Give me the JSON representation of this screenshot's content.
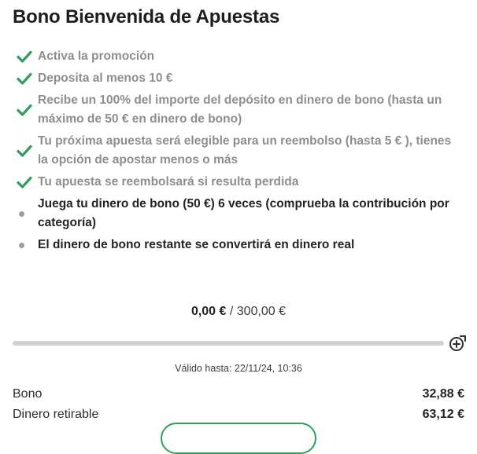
{
  "title": "Bono Bienvenida de Apuestas",
  "steps": [
    {
      "text": "Activa la promoción",
      "status": "done"
    },
    {
      "text": "Deposita al menos 10 €",
      "status": "done"
    },
    {
      "text": "Recibe un 100% del importe del depósito en dinero de bono (hasta un máximo de 50 € en dinero de bono)",
      "status": "done"
    },
    {
      "text": "Tu próxima apuesta será elegible para un reembolso (hasta 5 € ), tienes la opción de apostar menos o más",
      "status": "done"
    },
    {
      "text": "Tu apuesta se reembolsará si resulta perdida",
      "status": "done"
    },
    {
      "text": "Juega tu dinero de bono (50 €) 6 veces (comprueba la contribución por categoría)",
      "status": "pending"
    },
    {
      "text": "El dinero de bono restante se convertirá en dinero real",
      "status": "pending"
    }
  ],
  "progress": {
    "current": "0,00 €",
    "separator": " / ",
    "target": "300,00 €",
    "fraction": 0
  },
  "valid_until": "Válido hasta: 22/11/24, 10:36",
  "balances": {
    "bono_label": "Bono",
    "bono_value": "32,88 €",
    "retirable_label": "Dinero retirable",
    "retirable_value": "63,12 €"
  },
  "icons": {
    "done": "check-icon",
    "pending": "bullet-dot",
    "add": "plus-circle-icon"
  },
  "colors": {
    "accent": "#2e9e5b",
    "done_text": "#8b8f8d",
    "track": "#cfd2d0"
  }
}
